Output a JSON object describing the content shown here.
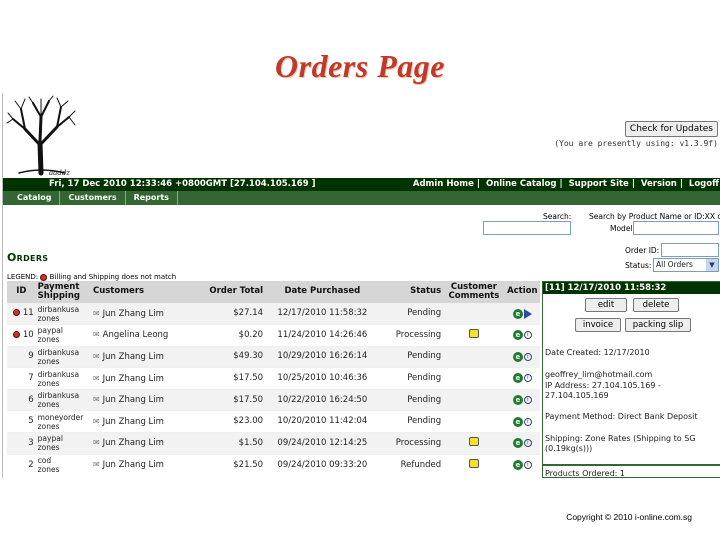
{
  "slide": {
    "title": "Orders Page",
    "copyright": "Copyright © 2010  i-online.com.sg"
  },
  "header": {
    "logo_text": "aaddz",
    "update_button": "Check for Updates",
    "version_note": "(You are presently using: v1.3.9f)"
  },
  "topbar": {
    "datetime": "Fri, 17 Dec 2010 12:33:46 +0800GMT [27.104.105.169 ]",
    "links": [
      "Admin Home",
      "Online Catalog",
      "Support Site",
      "Version",
      "Logoff"
    ]
  },
  "menu": [
    "Catalog",
    "Customers",
    "Reports"
  ],
  "filters": {
    "search_label": "Search:",
    "search_by_label": "Search by Product Name or ID:XX or",
    "model_label": "Model",
    "order_id_label": "Order ID:",
    "status_label": "Status:",
    "status_selected": "All Orders"
  },
  "page": {
    "heading": "Orders",
    "legend_label": "LEGEND:",
    "legend_text": "Billing and Shipping does not match"
  },
  "table": {
    "headers": {
      "id": "ID",
      "payment_shipping": "Payment Shipping",
      "customers": "Customers",
      "order_total": "Order Total",
      "date_purchased": "Date Purchased",
      "status": "Status",
      "customer_comments": "Customer Comments",
      "action": "Action"
    },
    "rows": [
      {
        "id": "11",
        "flag": true,
        "payment": "dirbankusa",
        "shipping": "zones",
        "customer": "Jun Zhang Lim",
        "total": "$27.14",
        "date": "12/17/2010 11:58:32",
        "status": "Pending",
        "comment": false,
        "selected": true
      },
      {
        "id": "10",
        "flag": true,
        "payment": "paypal",
        "shipping": "zones",
        "customer": "Angelina Leong",
        "total": "$0.20",
        "date": "11/24/2010 14:26:46",
        "status": "Processing",
        "comment": true,
        "selected": false
      },
      {
        "id": "9",
        "flag": false,
        "payment": "dirbankusa",
        "shipping": "zones",
        "customer": "Jun Zhang Lim",
        "total": "$49.30",
        "date": "10/29/2010 16:26:14",
        "status": "Pending",
        "comment": false,
        "selected": false
      },
      {
        "id": "7",
        "flag": false,
        "payment": "dirbankusa",
        "shipping": "zones",
        "customer": "Jun Zhang Lim",
        "total": "$17.50",
        "date": "10/25/2010 10:46:36",
        "status": "Pending",
        "comment": false,
        "selected": false
      },
      {
        "id": "6",
        "flag": false,
        "payment": "dirbankusa",
        "shipping": "zones",
        "customer": "Jun Zhang Lim",
        "total": "$17.50",
        "date": "10/22/2010 16:24:50",
        "status": "Pending",
        "comment": false,
        "selected": false
      },
      {
        "id": "5",
        "flag": false,
        "payment": "moneyorder",
        "shipping": "zones",
        "customer": "Jun Zhang Lim",
        "total": "$23.00",
        "date": "10/20/2010 11:42:04",
        "status": "Pending",
        "comment": false,
        "selected": false
      },
      {
        "id": "3",
        "flag": false,
        "payment": "paypal",
        "shipping": "zones",
        "customer": "Jun Zhang Lim",
        "total": "$1.50",
        "date": "09/24/2010 12:14:25",
        "status": "Processing",
        "comment": true,
        "selected": false
      },
      {
        "id": "2",
        "flag": false,
        "payment": "cod",
        "shipping": "zones",
        "customer": "Jun Zhang Lim",
        "total": "$21.50",
        "date": "09/24/2010 09:33:20",
        "status": "Refunded",
        "comment": true,
        "selected": false
      }
    ]
  },
  "panel": {
    "title": "[11]  12/17/2010 11:58:32",
    "buttons": {
      "edit": "edit",
      "delete": "delete",
      "invoice": "invoice",
      "packing_slip": "packing slip"
    },
    "date_created": "Date Created: 12/17/2010",
    "email": "geoffrey_lim@hotmail.com",
    "ip": "IP Address: 27.104.105.169 - 27.104.105.169",
    "payment_method": "Payment Method: Direct Bank Deposit",
    "shipping": "Shipping: Zone Rates (Shipping to SG (0.19kg(s)))",
    "products_ordered": "Products Ordered: 1"
  },
  "colors": {
    "title_red": "#c0392b",
    "topbar_green": "#003300",
    "menubar_green": "#336633",
    "comment_yellow": "#f5e12a"
  },
  "icons": [
    "tree-logo",
    "customer-icon",
    "edit-icon",
    "info-icon",
    "play-icon",
    "comment-icon",
    "flag-dot-icon",
    "dropdown-arrow-icon"
  ]
}
